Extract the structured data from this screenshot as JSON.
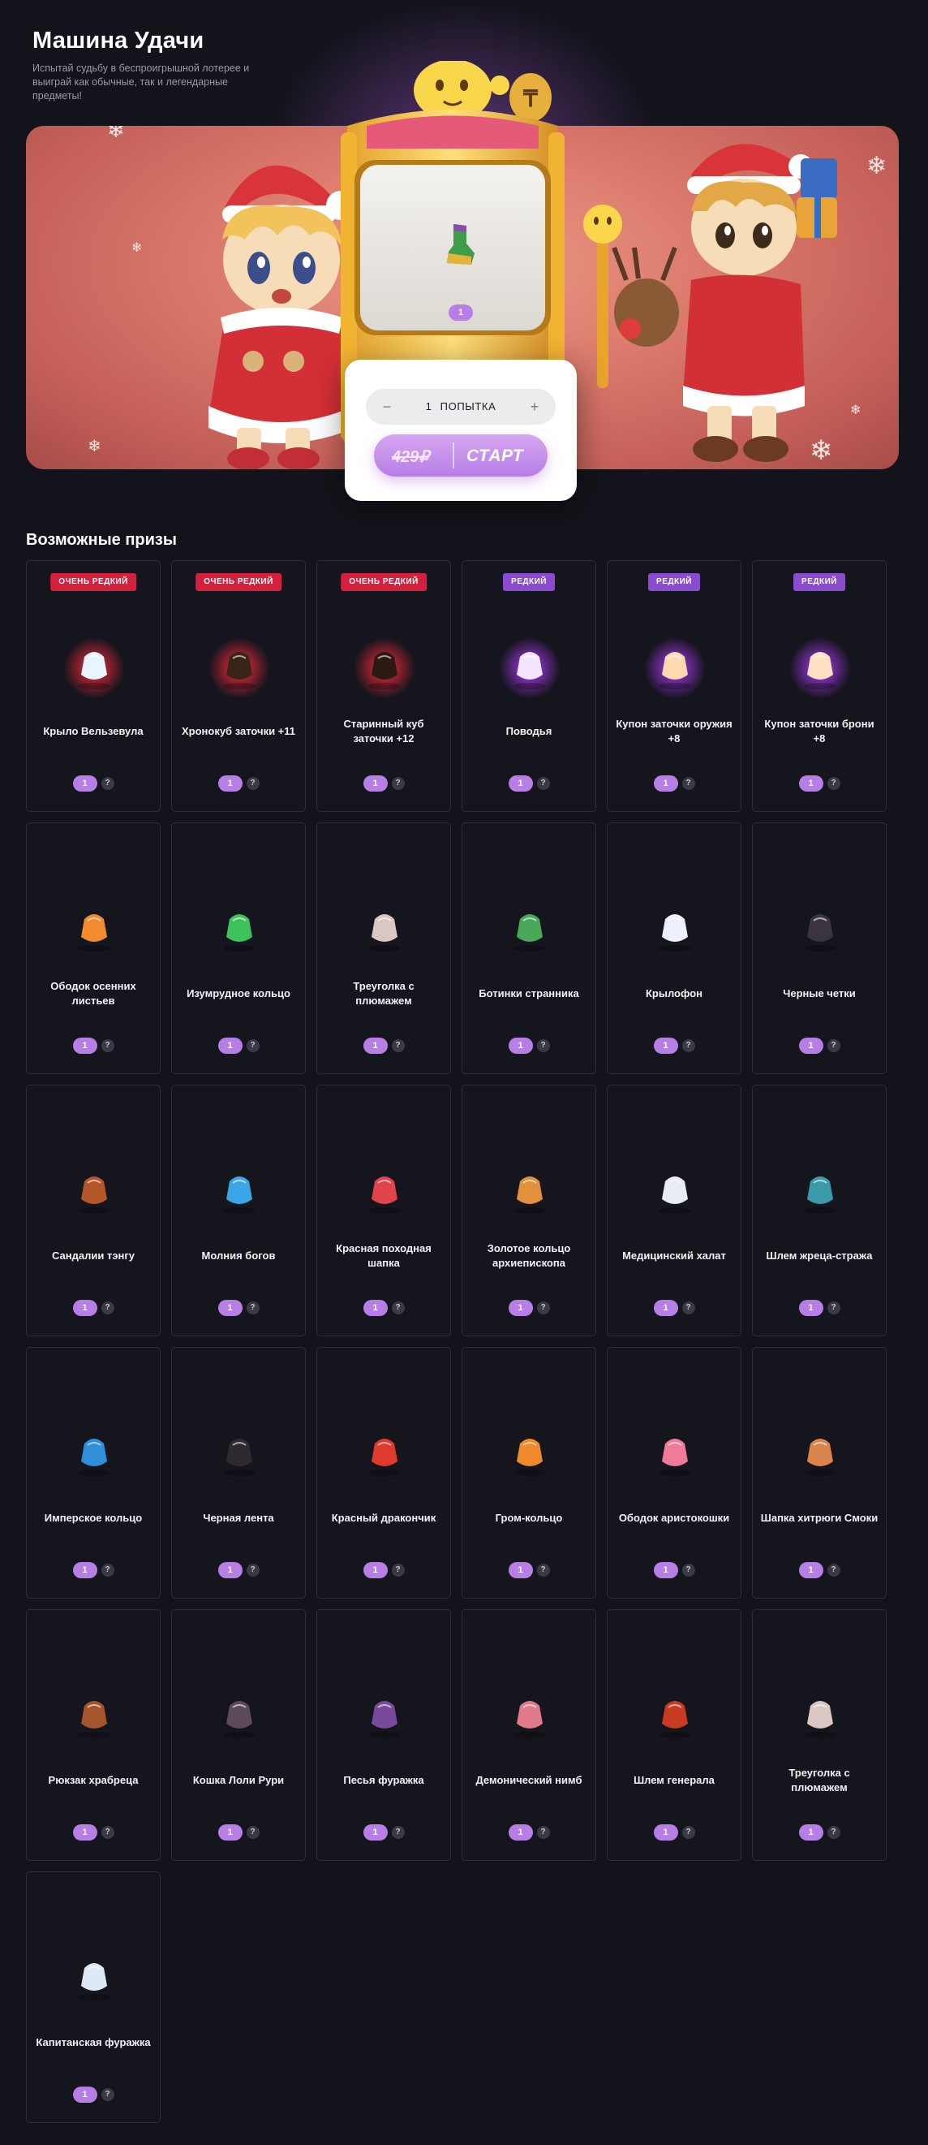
{
  "header": {
    "title": "Машина Удачи",
    "description": "Испытай судьбу в беспроигрышной лотерее и выиграй как обычные, так и легендарные предметы!"
  },
  "machine": {
    "slot_quantity": "1",
    "stepper": {
      "minus": "−",
      "count": "1",
      "unit": "ПОПЫТКА",
      "plus": "+"
    },
    "start": {
      "price": "429₽",
      "label": "СТАРТ"
    }
  },
  "prizes": {
    "title": "Возможные призы",
    "info_label": "?",
    "items": [
      {
        "name": "Крыло Вельзевула",
        "qty": "1",
        "badge": "Очень редкий",
        "rarity": "very-rare",
        "icon": "wing-icon",
        "color": "#e8f4ff",
        "glow": "#ff2b3c"
      },
      {
        "name": "Хронокуб заточки +11",
        "qty": "1",
        "badge": "Очень редкий",
        "rarity": "very-rare",
        "icon": "cube-icon",
        "color": "#3a2418",
        "glow": "#ff2b3c"
      },
      {
        "name": "Старинный куб заточки +12",
        "qty": "1",
        "badge": "Очень редкий",
        "rarity": "very-rare",
        "icon": "cube-icon",
        "color": "#2a1a12",
        "glow": "#ff2b3c"
      },
      {
        "name": "Поводья",
        "qty": "1",
        "badge": "Редкий",
        "rarity": "rare",
        "icon": "reins-icon",
        "color": "#f3e4ff",
        "glow": "#b23cff"
      },
      {
        "name": "Купон заточки оружия +8",
        "qty": "1",
        "badge": "Редкий",
        "rarity": "rare",
        "icon": "coupon-icon",
        "color": "#ffd9b0",
        "glow": "#b23cff"
      },
      {
        "name": "Купон заточки брони +8",
        "qty": "1",
        "badge": "Редкий",
        "rarity": "rare",
        "icon": "coupon-icon",
        "color": "#ffe0c2",
        "glow": "#b23cff"
      },
      {
        "name": "Ободок осенних листьев",
        "qty": "1",
        "icon": "leaf-headband-icon",
        "color": "#f28a2e"
      },
      {
        "name": "Изумрудное кольцо",
        "qty": "1",
        "icon": "ring-icon",
        "color": "#3ec25c"
      },
      {
        "name": "Треуголка с плюмажем",
        "qty": "1",
        "icon": "tricorn-hat-icon",
        "color": "#d8c7c2"
      },
      {
        "name": "Ботинки странника",
        "qty": "1",
        "icon": "boots-icon",
        "color": "#4aa85a"
      },
      {
        "name": "Крылофон",
        "qty": "1",
        "icon": "winged-headphones-icon",
        "color": "#eef0ff"
      },
      {
        "name": "Черные четки",
        "qty": "1",
        "icon": "beads-icon",
        "color": "#3a3340"
      },
      {
        "name": "Сандалии тэнгу",
        "qty": "1",
        "icon": "sandals-icon",
        "color": "#b5562a"
      },
      {
        "name": "Молния богов",
        "qty": "1",
        "icon": "lightning-icon",
        "color": "#3aa6e6"
      },
      {
        "name": "Красная походная шапка",
        "qty": "1",
        "icon": "hat-icon",
        "color": "#e0434a"
      },
      {
        "name": "Золотое кольцо архиепископа",
        "qty": "1",
        "icon": "ring-icon",
        "color": "#e2913a"
      },
      {
        "name": "Медицинский халат",
        "qty": "1",
        "icon": "coat-icon",
        "color": "#e9ecf2"
      },
      {
        "name": "Шлем жреца-стража",
        "qty": "1",
        "icon": "helmet-icon",
        "color": "#3a9aa8"
      },
      {
        "name": "Имперское кольцо",
        "qty": "1",
        "icon": "ring-icon",
        "color": "#2f8fd8"
      },
      {
        "name": "Черная лента",
        "qty": "1",
        "icon": "ribbon-icon",
        "color": "#2e2a30"
      },
      {
        "name": "Красный дракончик",
        "qty": "1",
        "icon": "dragon-icon",
        "color": "#e03a2e"
      },
      {
        "name": "Гром-кольцо",
        "qty": "1",
        "icon": "ring-icon",
        "color": "#ef8a2a"
      },
      {
        "name": "Ободок аристокошки",
        "qty": "1",
        "icon": "cat-ears-icon",
        "color": "#f07a9a"
      },
      {
        "name": "Шапка хитрюги Смоки",
        "qty": "1",
        "icon": "raccoon-hat-icon",
        "color": "#d9844a"
      },
      {
        "name": "Рюкзак храбреца",
        "qty": "1",
        "icon": "backpack-icon",
        "color": "#a5552c"
      },
      {
        "name": "Кошка Лоли Рури",
        "qty": "1",
        "icon": "cat-icon",
        "color": "#5d4a58"
      },
      {
        "name": "Песья фуражка",
        "qty": "1",
        "icon": "cap-icon",
        "color": "#7a4a9a"
      },
      {
        "name": "Демонический нимб",
        "qty": "1",
        "icon": "halo-icon",
        "color": "#e07a8a"
      },
      {
        "name": "Шлем генерала",
        "qty": "1",
        "icon": "helmet-icon",
        "color": "#c83a22"
      },
      {
        "name": "Треуголка с плюмажем",
        "qty": "1",
        "icon": "tricorn-hat-icon",
        "color": "#d8c7c2"
      },
      {
        "name": "Капитанская фуражка",
        "qty": "1",
        "icon": "captain-cap-icon",
        "color": "#dfe8f7"
      }
    ]
  }
}
